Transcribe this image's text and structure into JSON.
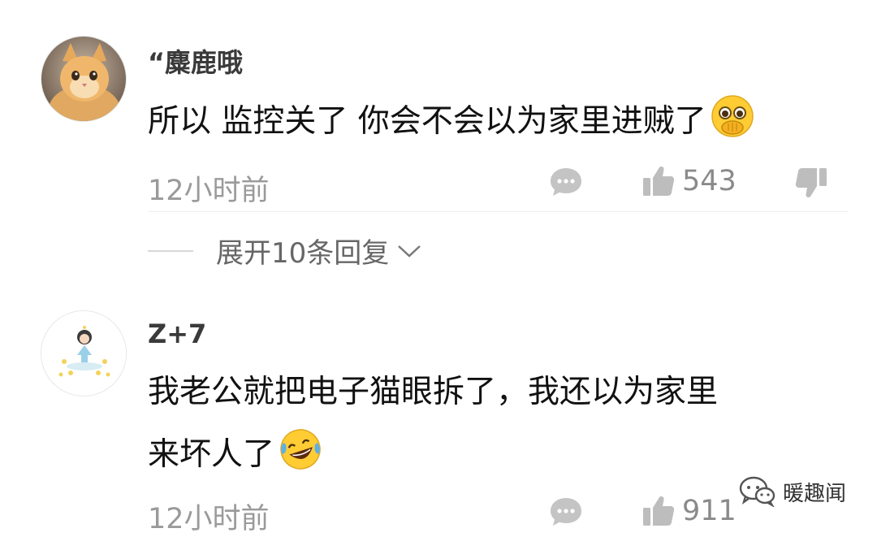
{
  "comments": [
    {
      "username": "“麋鹿哦",
      "avatar": "cat-avatar",
      "content_lines": [
        "所以 监控关了 你会不会以为家里进贼了"
      ],
      "emoji": "pleading-face-emoji",
      "time": "12小时前",
      "likes": "543",
      "replies_label": "展开10条回复"
    },
    {
      "username": "Z+7",
      "avatar": "illustration-girl-avatar",
      "content_lines": [
        "我老公就把电子猫眼拆了，我还以为家里",
        "来坏人了"
      ],
      "emoji": "laughing-tears-emoji",
      "time": "12小时前",
      "likes": "911"
    }
  ],
  "watermark": {
    "icon": "wechat-icon",
    "text": "暖趣闻"
  },
  "colors": {
    "text_primary": "#111111",
    "text_secondary": "#9a9a9a",
    "username": "#3a3a3a",
    "icon_gray": "#b8b8b8",
    "emoji_yellow": "#ffcc33"
  }
}
